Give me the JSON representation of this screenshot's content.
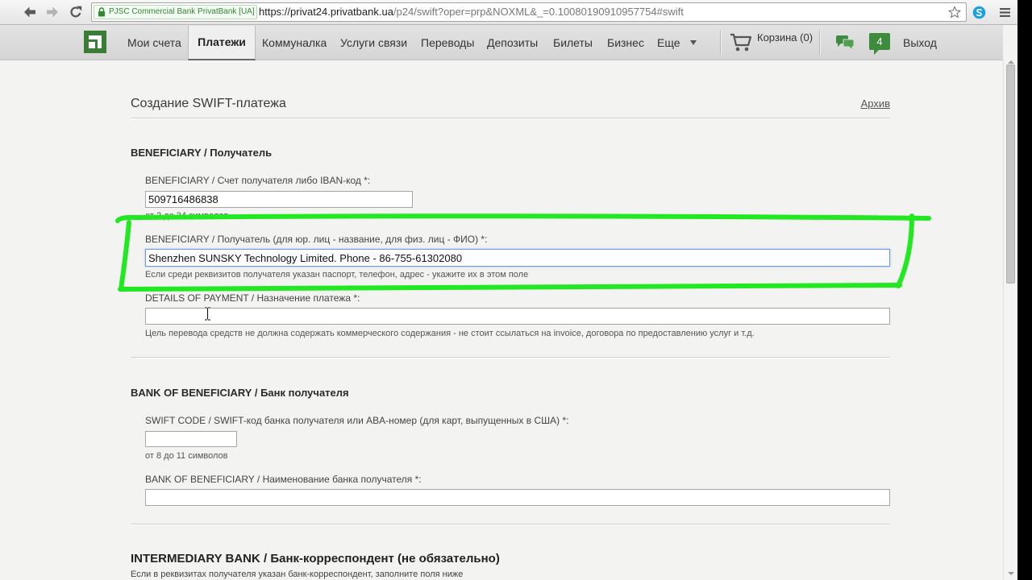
{
  "browser": {
    "ev_badge": "PJSC Commercial Bank PrivatBank [UA]",
    "url_host": "https://privat24.privatbank.ua",
    "url_path": "/p24/swift?oper=prp&NOXML&_=0.10080190910957754#swift",
    "icons": {
      "back": "back-arrow-icon",
      "forward": "forward-arrow-icon",
      "reload": "reload-icon",
      "secure": "lock-icon",
      "bookmark": "star-icon",
      "extension": "skype-icon",
      "menu": "menu-icon"
    }
  },
  "nav": {
    "logo_icon": "privatbank-logo-icon",
    "items": [
      {
        "label": "Мои счета",
        "active": false
      },
      {
        "label": "Платежи",
        "active": true
      },
      {
        "label": "Коммуналка",
        "active": false
      },
      {
        "label": "Услуги связи",
        "active": false
      },
      {
        "label": "Переводы",
        "active": false
      },
      {
        "label": "Депозиты",
        "active": false
      },
      {
        "label": "Билеты",
        "active": false
      },
      {
        "label": "Бизнес",
        "active": false
      },
      {
        "label": "Еще",
        "active": false,
        "icon": "chevron-down-icon"
      }
    ],
    "cart": {
      "label": "Корзина (0)",
      "icon": "cart-icon"
    },
    "messages_icon": "chat-icon",
    "notifications": {
      "count": "4"
    },
    "logout_label": "Выход"
  },
  "form": {
    "title": "Создание SWIFT-платежа",
    "archive_link": "Архив",
    "beneficiary": {
      "heading": "BENEFICIARY / Получатель",
      "account": {
        "label": "BENEFICIARY / Счет получателя либо IBAN-код *:",
        "value": "509716486838",
        "hint": "от 2 до 34 символов"
      },
      "name": {
        "label": "BENEFICIARY / Получатель (для юр. лиц - название, для физ. лиц - ФИО) *:",
        "value": "Shenzhen SUNSKY Technology Limited. Phone - 86-755-61302080",
        "hint": "Если среди реквизитов получателя указан паспорт, телефон, адрес - укажите их в этом поле",
        "focused": true
      },
      "details": {
        "label": "DETAILS OF PAYMENT / Назначение платежа *:",
        "value": "",
        "hint": "Цель перевода средств не должна содержать коммерческого содержания - не стоит ссылаться на invoice, договора по предоставлению услуг и т.д."
      }
    },
    "bank": {
      "heading": "BANK OF BENEFICIARY / Банк получателя",
      "swift": {
        "label": "SWIFT CODE / SWIFT-код банка получателя или ABA-номер (для карт, выпущенных в США) *:",
        "value": "",
        "hint": "от 8 до 11 символов"
      },
      "bank_name": {
        "label": "BANK OF BENEFICIARY / Наименование банка получателя *:",
        "value": ""
      }
    },
    "intermediary": {
      "heading": "INTERMEDIARY BANK / Банк-корреспондент (не обязательно)",
      "note": "Если в реквизитах получателя указан банк-корреспондент, заполните поля ниже"
    }
  },
  "colors": {
    "annotation": "#22e822",
    "brand_green": "#3d8b3d",
    "focus_border": "#6b9de0",
    "page_background": "#f3f3f1",
    "nav_background": "#dcdcdc"
  }
}
